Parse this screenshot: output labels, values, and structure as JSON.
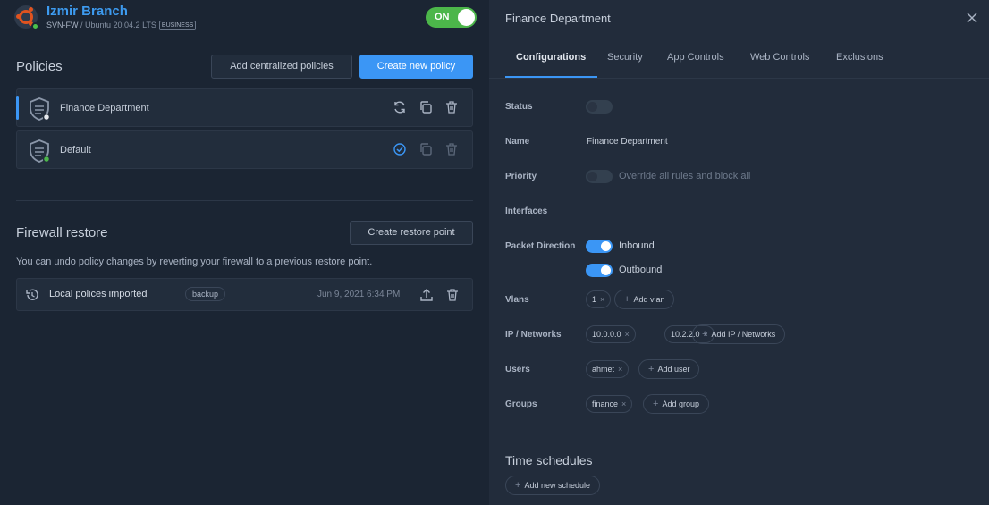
{
  "header": {
    "branch_name": "Izmir Branch",
    "device": "SVN-FW",
    "os": "Ubuntu 20.04.2 LTS",
    "edition": "BUSINESS",
    "toggle_label": "ON"
  },
  "policies": {
    "title": "Policies",
    "add_centralized_label": "Add centralized policies",
    "create_new_label": "Create new policy",
    "items": [
      {
        "name": "Finance Department"
      },
      {
        "name": "Default"
      }
    ]
  },
  "restore": {
    "title": "Firewall restore",
    "create_label": "Create restore point",
    "description": "You can undo policy changes by reverting your firewall to a previous restore point.",
    "items": [
      {
        "name": "Local polices imported",
        "tag": "backup",
        "date": "Jun 9, 2021 6:34 PM"
      }
    ]
  },
  "panel": {
    "title": "Finance Department",
    "tabs": [
      "Configurations",
      "Security",
      "App Controls",
      "Web Controls",
      "Exclusions"
    ],
    "fields": {
      "status_label": "Status",
      "name_label": "Name",
      "name_value": "Finance Department",
      "priority_label": "Priority",
      "priority_text": "Override all rules and block all",
      "interfaces_label": "Interfaces",
      "packet_label": "Packet Direction",
      "inbound": "Inbound",
      "outbound": "Outbound",
      "vlans_label": "Vlans",
      "vlans": [
        "1"
      ],
      "add_vlan": "Add vlan",
      "ip_label": "IP / Networks",
      "ips": [
        "10.0.0.0",
        "10.2.2.0"
      ],
      "add_ip": "Add IP / Networks",
      "users_label": "Users",
      "users": [
        "ahmet"
      ],
      "add_user": "Add user",
      "groups_label": "Groups",
      "groups": [
        "finance"
      ],
      "add_group": "Add group"
    },
    "schedules_title": "Time schedules",
    "add_schedule": "Add new schedule"
  },
  "colors": {
    "accent": "#3b96f5",
    "success": "#4cb64a",
    "brand_orange": "#e0531f"
  }
}
